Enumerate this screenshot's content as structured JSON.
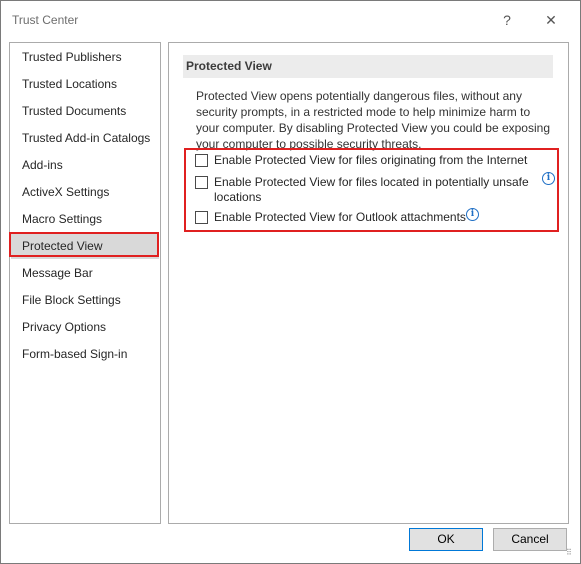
{
  "window": {
    "title": "Trust Center",
    "help_glyph": "?",
    "close_glyph": "✕"
  },
  "sidebar": {
    "items": [
      {
        "label": "Trusted Publishers"
      },
      {
        "label": "Trusted Locations"
      },
      {
        "label": "Trusted Documents"
      },
      {
        "label": "Trusted Add-in Catalogs"
      },
      {
        "label": "Add-ins"
      },
      {
        "label": "ActiveX Settings"
      },
      {
        "label": "Macro Settings"
      },
      {
        "label": "Protected View"
      },
      {
        "label": "Message Bar"
      },
      {
        "label": "File Block Settings"
      },
      {
        "label": "Privacy Options"
      },
      {
        "label": "Form-based Sign-in"
      }
    ],
    "selected": "Protected View"
  },
  "content": {
    "section_title": "Protected View",
    "description": "Protected View opens potentially dangerous files, without any security prompts, in a restricted mode to help minimize harm to your computer. By disabling Protected View you could be exposing your computer to possible security threats.",
    "options": [
      {
        "label": "Enable Protected View for files originating from the Internet",
        "checked": false,
        "has_info": false
      },
      {
        "label": "Enable Protected View for files located in potentially unsafe",
        "label_line2": "locations",
        "checked": false,
        "has_info": true
      },
      {
        "label": "Enable Protected View for Outlook attachments",
        "checked": false,
        "has_info": true
      }
    ],
    "info_glyph": "i"
  },
  "footer": {
    "ok_label": "OK",
    "cancel_label": "Cancel"
  },
  "colors": {
    "highlight": "#e02020",
    "selected_bg": "#d9d9d9",
    "info_blue": "#1f6fc5"
  }
}
